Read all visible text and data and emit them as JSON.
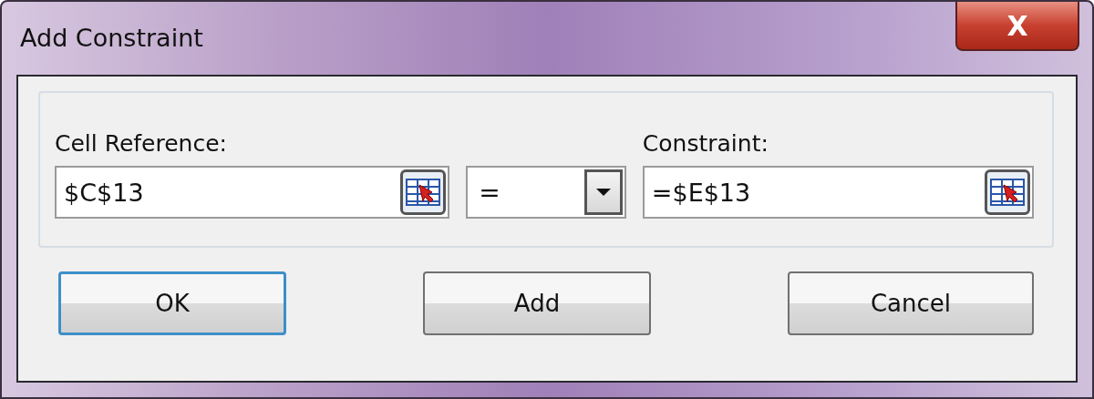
{
  "window": {
    "title": "Add Constraint",
    "close_label": "X"
  },
  "cell_reference": {
    "label": "Cell Reference:",
    "value": "$C$13"
  },
  "operator": {
    "value": "="
  },
  "constraint": {
    "label": "Constraint:",
    "value": "=$E$13"
  },
  "buttons": [
    {
      "label": "OK",
      "default": true
    },
    {
      "label": "Add",
      "default": false
    },
    {
      "label": "Cancel",
      "default": false
    }
  ]
}
